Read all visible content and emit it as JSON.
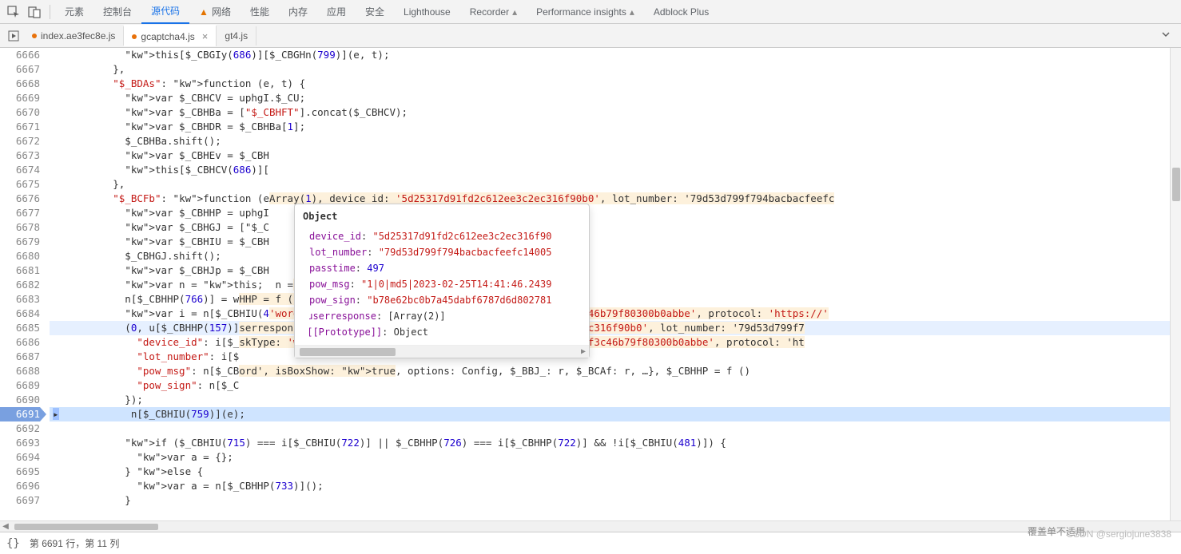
{
  "toolbar": {
    "tabs": [
      "元素",
      "控制台",
      "源代码",
      "网络",
      "性能",
      "内存",
      "应用",
      "安全",
      "Lighthouse",
      "Recorder",
      "Performance insights",
      "Adblock Plus"
    ],
    "active": "源代码"
  },
  "fileTabs": {
    "items": [
      {
        "name": "index.ae3fec8e.js",
        "active": false,
        "modified": true
      },
      {
        "name": "gcaptcha4.js",
        "active": true,
        "modified": true
      },
      {
        "name": "gt4.js",
        "active": false,
        "modified": false
      }
    ]
  },
  "code": {
    "start": 6666,
    "activeLine": 6691,
    "breakpointLine": 6685,
    "lines": [
      "            this[$_CBGIy(686)][$_CBGHn(799)](e, t);",
      "          },",
      "          \"$_BDAs\": function (e, t) {",
      "            var $_CBHCV = uphgI.$_CU;",
      "            var $_CBHBa = [\"$_CBHFT\"].concat($_CBHCV);",
      "            var $_CBHDR = $_CBHBa[1];",
      "            $_CBHBa.shift();",
      "            var $_CBHEv = $_CBH",
      "            this[$_CBHCV(686)][",
      "          },",
      "          \"$_BCFb\": function (e                                   Array(1), device_id: '5d25317d91fd2c612ee3c2ec316f90b0', lot_number: '79d53d799f794bacbacfeefc",
      "            var $_CBHHP = uphgI",
      "            var $_CBHGJ = [\"$_C",
      "            var $_CBHIU = $_CBH",
      "            $_CBHGJ.shift();",
      "            var $_CBHJp = $_CBH",
      "            var n = this;  n =                                    : Config, $_BBJ_: r, $_BCAf: r, …}",
      "            n[$_CBHHP(766)] = w                                   HHP = f ()",
      "            var i = n[$_CBHIU(4                                   'word', product: 'float', captchaId: '54088bb07d2df3c46b79f80300b0abbe', protocol: 'https://'",
      "            (0, u[$_CBHHP(157)]                                   serresponse: Array(1), device_id: '5d25317d91fd2c612ee3c2ec316f90b0', lot_number: '79d53d799f7",
      "              \"device_id\": i[$_                                   skType: 'word', product: 'float', captchaId: '54088bb07d2df3c46b79f80300b0abbe', protocol: 'ht",
      "              \"lot_number\": i[$",
      "              \"pow_msg\": n[$_CB                                   ord', isBoxShow: true, options: Config, $_BBJ_: r, $_BCAf: r, …}, $_CBHHP = f ()",
      "              \"pow_sign\": n[$_C",
      "            });",
      "            n[$_CBHIU(759)](e);",
      "",
      "            if ($_CBHIU(715) === i[$_CBHIU(722)] || $_CBHHP(726) === i[$_CBHHP(722)] && !i[$_CBHIU(481)]) {",
      "              var a = {};",
      "            } else {",
      "              var a = n[$_CBHHP(733)]();",
      "            }"
    ]
  },
  "tooltip": {
    "title": "Object",
    "rows": [
      {
        "k": "device_id",
        "v": "\"5d25317d91fd2c612ee3c2ec316f90",
        "t": "str"
      },
      {
        "k": "lot_number",
        "v": "\"79d53d799f794bacbacfeefc14005",
        "t": "str"
      },
      {
        "k": "passtime",
        "v": "497",
        "t": "num"
      },
      {
        "k": "pow_msg",
        "v": "\"1|0|md5|2023-02-25T14:41:46.2439",
        "t": "str"
      },
      {
        "k": "pow_sign",
        "v": "\"b78e62bc0b7a45dabf6787d6d802781",
        "t": "str"
      },
      {
        "k": "userresponse",
        "v": "[Array(2)]",
        "t": "obj",
        "arrow": true
      },
      {
        "k": "[[Prototype]]",
        "v": "Object",
        "t": "obj",
        "arrow": true
      }
    ]
  },
  "status": {
    "text": "第 6691 行，第 11 列"
  },
  "watermark": "CSDN @sergiojune3838",
  "watermark2": "覆盖单不适用"
}
